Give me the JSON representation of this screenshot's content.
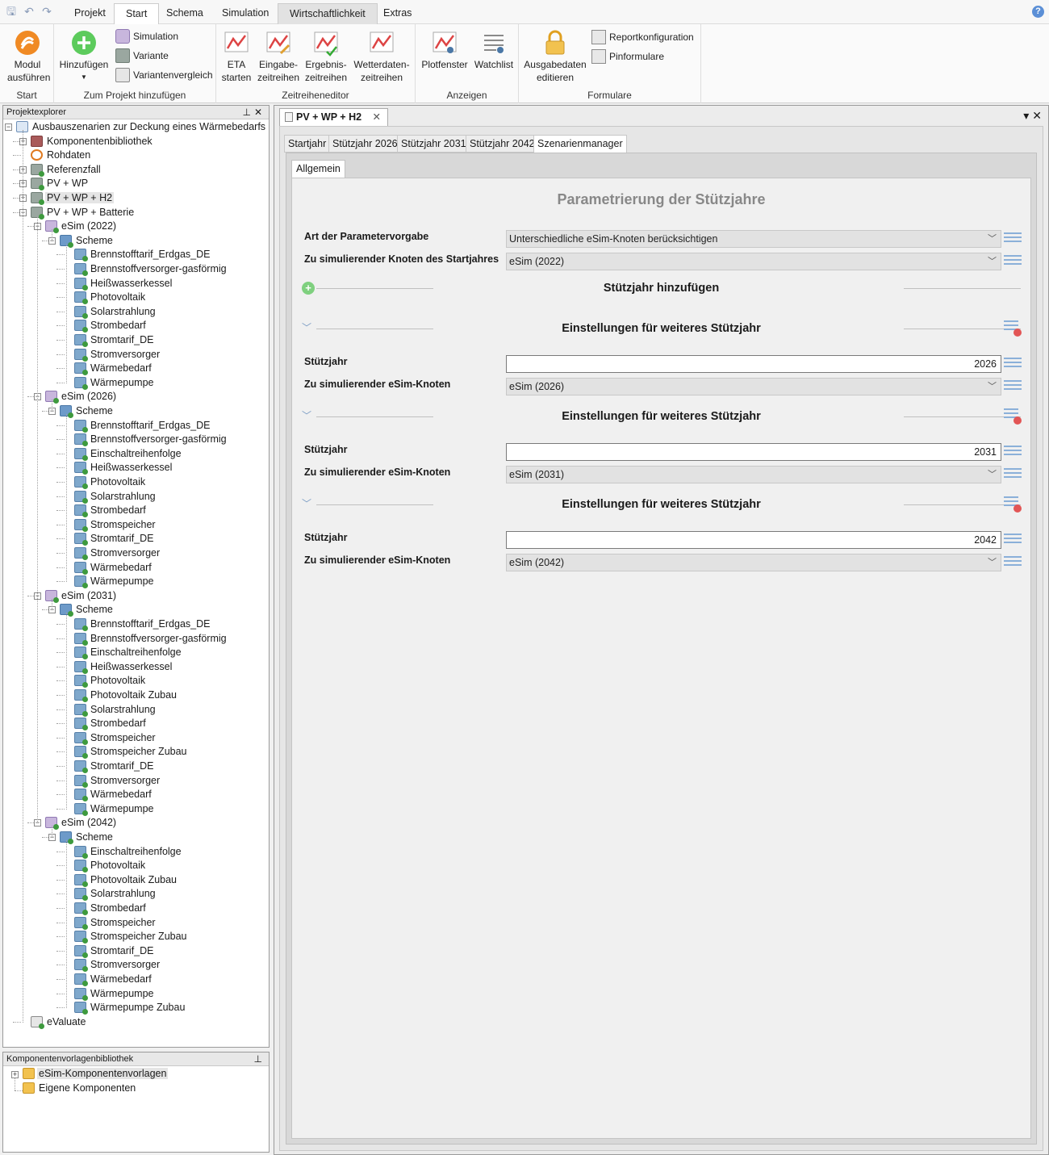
{
  "menubar": {
    "tabs": [
      "Projekt",
      "Start",
      "Schema",
      "Simulation",
      "Wirtschaftlichkeit",
      "Extras"
    ],
    "selected_tab": "Start",
    "help": "?"
  },
  "ribbon": {
    "groups": {
      "start": {
        "label": "Start",
        "modul": "Modul ausführen"
      },
      "projekt": {
        "label": "Zum Projekt hinzufügen",
        "hinzufuegen": "Hinzufügen",
        "simulation": "Simulation",
        "variante": "Variante",
        "variantenvergleich": "Variantenvergleich"
      },
      "zeitreihen": {
        "label": "Zeitreiheneditor",
        "eta_1": "ETA",
        "eta_2": "starten",
        "eingabe_1": "Eingabe-",
        "eingabe_2": "zeitreihen",
        "ergebnis_1": "Ergebnis-",
        "ergebnis_2": "zeitreihen",
        "wetter_1": "Wetterdaten-",
        "wetter_2": "zeitreihen"
      },
      "anzeigen": {
        "label": "Anzeigen",
        "plot": "Plotfenster",
        "watch": "Watchlist"
      },
      "formulare": {
        "label": "Formulare",
        "ausgabe_1": "Ausgabedaten",
        "ausgabe_2": "editieren",
        "report": "Reportkonfiguration",
        "pin": "Pinformulare"
      }
    }
  },
  "project_explorer": {
    "title": "Projektexplorer",
    "root": "Ausbauszenarien zur Deckung eines Wärmebedarfs",
    "top_items": [
      "Komponentenbibliothek",
      "Rohdaten",
      "Referenzfall",
      "PV + WP",
      "PV + WP + H2",
      "PV + WP + Batterie"
    ],
    "selected": "PV + WP + H2",
    "scheme_label": "Scheme",
    "esim": [
      {
        "name": "eSim (2022)",
        "components": [
          "Brennstofftarif_Erdgas_DE",
          "Brennstoffversorger-gasförmig",
          "Heißwasserkessel",
          "Photovoltaik",
          "Solarstrahlung",
          "Strombedarf",
          "Stromtarif_DE",
          "Stromversorger",
          "Wärmebedarf",
          "Wärmepumpe"
        ]
      },
      {
        "name": "eSim (2026)",
        "components": [
          "Brennstofftarif_Erdgas_DE",
          "Brennstoffversorger-gasförmig",
          "Einschaltreihenfolge",
          "Heißwasserkessel",
          "Photovoltaik",
          "Solarstrahlung",
          "Strombedarf",
          "Stromspeicher",
          "Stromtarif_DE",
          "Stromversorger",
          "Wärmebedarf",
          "Wärmepumpe"
        ]
      },
      {
        "name": "eSim (2031)",
        "components": [
          "Brennstofftarif_Erdgas_DE",
          "Brennstoffversorger-gasförmig",
          "Einschaltreihenfolge",
          "Heißwasserkessel",
          "Photovoltaik",
          "Photovoltaik Zubau",
          "Solarstrahlung",
          "Strombedarf",
          "Stromspeicher",
          "Stromspeicher Zubau",
          "Stromtarif_DE",
          "Stromversorger",
          "Wärmebedarf",
          "Wärmepumpe"
        ]
      },
      {
        "name": "eSim (2042)",
        "components": [
          "Einschaltreihenfolge",
          "Photovoltaik",
          "Photovoltaik Zubau",
          "Solarstrahlung",
          "Strombedarf",
          "Stromspeicher",
          "Stromspeicher Zubau",
          "Stromtarif_DE",
          "Stromversorger",
          "Wärmebedarf",
          "Wärmepumpe",
          "Wärmepumpe Zubau"
        ]
      }
    ],
    "evaluate": "eValuate"
  },
  "library": {
    "title": "Komponentenvorlagenbibliothek",
    "items": [
      "eSim-Komponentenvorlagen",
      "Eigene Komponenten"
    ]
  },
  "document": {
    "tab_title": "PV + WP + H2",
    "subtabs": [
      "Startjahr",
      "Stützjahr 2026",
      "Stützjahr 2031",
      "Stützjahr 2042",
      "Szenarienmanager"
    ],
    "selected_subtab": "Szenarienmanager",
    "inner_tab": "Allgemein",
    "form_title": "Parametrierung der Stützjahre",
    "art_label": "Art der Parametervorgabe",
    "art_value": "Unterschiedliche eSim-Knoten berücksichtigen",
    "start_knoten_label": "Zu simulierender Knoten des Startjahres",
    "start_knoten_value": "eSim (2022)",
    "add_label": "Stützjahr hinzufügen",
    "section_title": "Einstellungen für weiteres Stützjahr",
    "year_label": "Stützjahr",
    "knoten_label": "Zu simulierender eSim-Knoten",
    "years": [
      {
        "year": "2026",
        "knoten": "eSim (2026)"
      },
      {
        "year": "2031",
        "knoten": "eSim (2031)"
      },
      {
        "year": "2042",
        "knoten": "eSim (2042)"
      }
    ]
  }
}
